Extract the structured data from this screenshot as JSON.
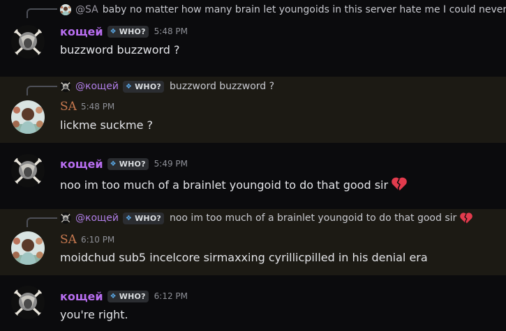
{
  "messages": [
    {
      "reply": {
        "author": "@SA",
        "text": "baby no matter how many brain let youngoids in this server hate me I could never hate on nobody"
      },
      "author": "кощей",
      "tag": "WHO?",
      "time": "5:48 PM",
      "content": "buzzword buzzword ?"
    },
    {
      "reply": {
        "author": "@кощей",
        "tag": "WHO?",
        "text": "buzzword buzzword ?"
      },
      "author": "SA",
      "time": "5:48 PM",
      "content": "lickme suckme ?"
    },
    {
      "author": "кощей",
      "tag": "WHO?",
      "time": "5:49 PM",
      "content": "noo im too much of a brainlet youngoid to do that good sir",
      "emoji": "broken-heart"
    },
    {
      "reply": {
        "author": "@кощей",
        "tag": "WHO?",
        "text": "noo im too much of a brainlet youngoid to do that good sir",
        "emoji": "broken-heart"
      },
      "author": "SA",
      "time": "6:10 PM",
      "content": "moidchud sub5 incelcore sirmaxxing cyrillicpilled in his denial era"
    },
    {
      "author": "кощей",
      "tag": "WHO?",
      "time": "6:12 PM",
      "content": "you're right."
    }
  ],
  "colors": {
    "background": "#0b0b0d",
    "highlight": "#1c1a14",
    "koschei_name": "#b86ef0",
    "sa_name": "#c97a50",
    "heart": "#e23b4d"
  }
}
